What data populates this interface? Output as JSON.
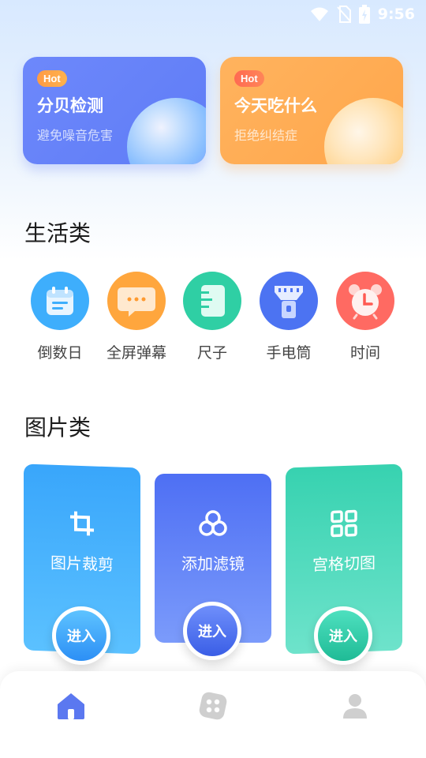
{
  "status_bar": {
    "time": "9:56",
    "icons": [
      "wifi-icon",
      "no-sim-icon",
      "battery-charging-icon"
    ]
  },
  "hot_cards": [
    {
      "badge": "Hot",
      "title": "分贝检测",
      "subtitle": "避免噪音危害",
      "color": "#6a84fa"
    },
    {
      "badge": "Hot",
      "title": "今天吃什么",
      "subtitle": "拒绝纠结症",
      "color": "#ffab55"
    }
  ],
  "life_section": {
    "title": "生活类",
    "tools": [
      {
        "label": "倒数日",
        "icon": "calendar-icon",
        "color": "#3eaefc"
      },
      {
        "label": "全屏弹幕",
        "icon": "chat-bubble-icon",
        "color": "#ffa63d"
      },
      {
        "label": "尺子",
        "icon": "ruler-icon",
        "color": "#2fcfa4"
      },
      {
        "label": "手电筒",
        "icon": "flashlight-icon",
        "color": "#4c73f2"
      },
      {
        "label": "时间",
        "icon": "alarm-clock-icon",
        "color": "#ff6a62"
      }
    ]
  },
  "image_section": {
    "title": "图片类",
    "cards": [
      {
        "label": "图片裁剪",
        "icon": "crop-icon",
        "button": "进入",
        "color": "#3fb0fb"
      },
      {
        "label": "添加滤镜",
        "icon": "filter-icon",
        "button": "进入",
        "color": "#5a7cf5"
      },
      {
        "label": "宫格切图",
        "icon": "grid-icon",
        "button": "进入",
        "color": "#3fd6b4"
      }
    ]
  },
  "bottom_nav": {
    "items": [
      {
        "icon": "home-icon",
        "active": true,
        "color": "#5b78f0"
      },
      {
        "icon": "apps-icon",
        "active": false,
        "color": "#cfcfcf"
      },
      {
        "icon": "profile-icon",
        "active": false,
        "color": "#cfcfcf"
      }
    ]
  }
}
